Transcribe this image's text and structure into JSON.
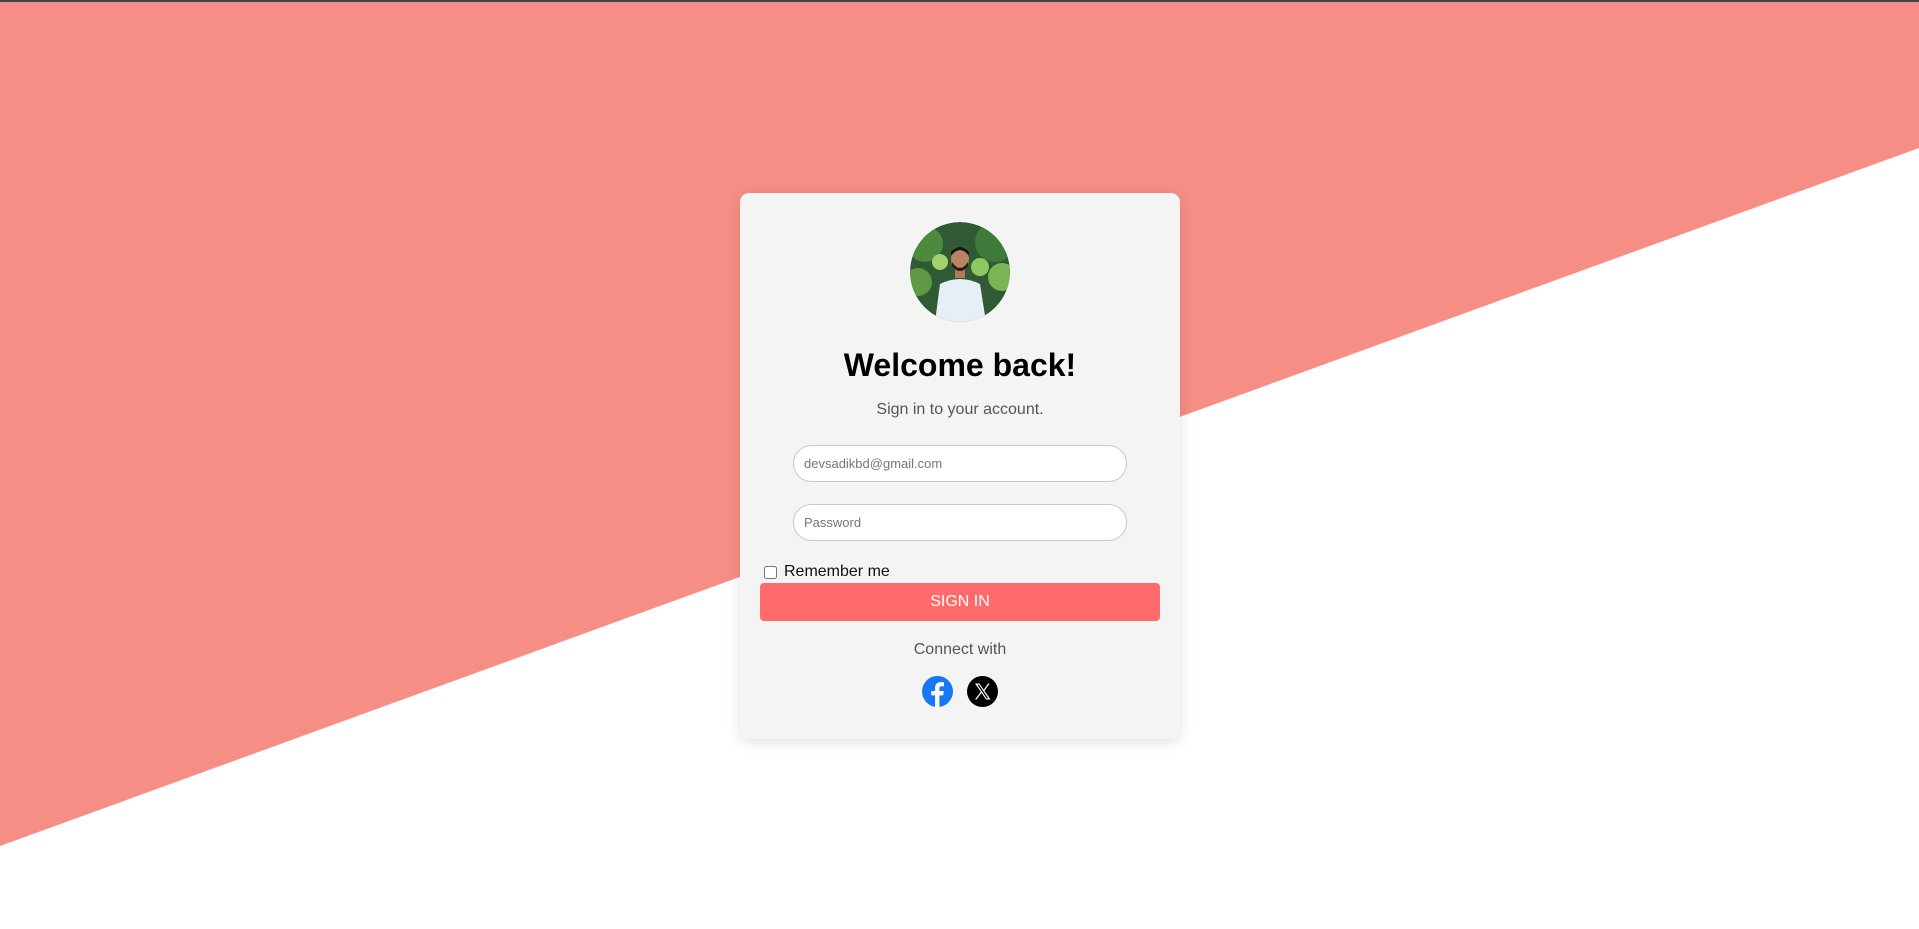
{
  "colors": {
    "accent": "#f78e85",
    "button": "#ff6b6b",
    "card": "#f4f4f4",
    "facebook": "#1877f2",
    "x": "#000000"
  },
  "login": {
    "avatar_icon": "user-avatar-photo",
    "title": "Welcome back!",
    "subtitle": "Sign in to your account.",
    "email_placeholder": "devsadikbd@gmail.com",
    "password_placeholder": "Password",
    "remember_label": "Remember me",
    "remember_checked": false,
    "signin_label": "SIGN IN",
    "connect_label": "Connect with",
    "socials": [
      {
        "name": "facebook",
        "icon": "facebook-icon"
      },
      {
        "name": "x",
        "icon": "x-icon"
      }
    ]
  }
}
